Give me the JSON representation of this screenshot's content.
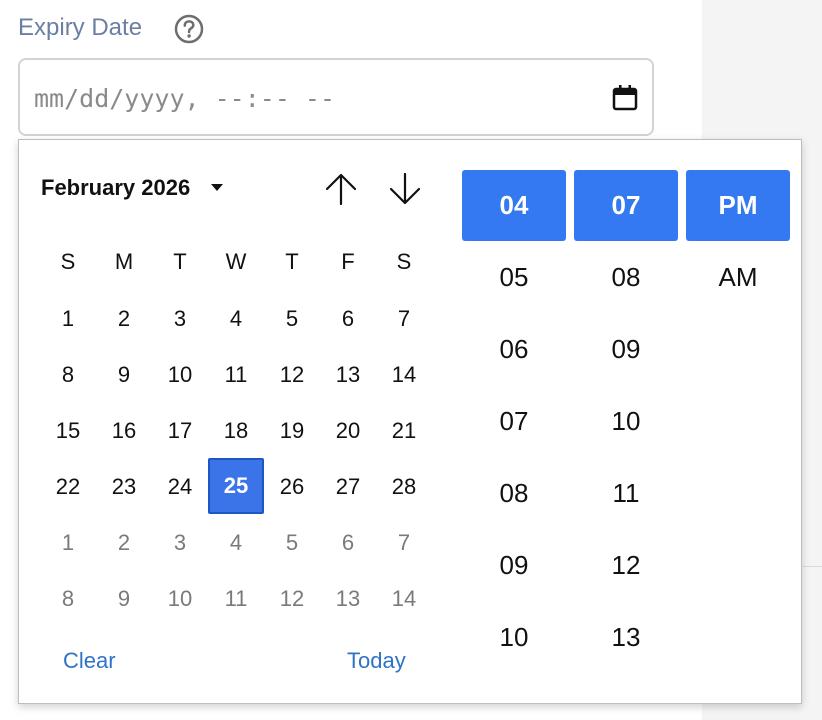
{
  "field": {
    "label": "Expiry Date",
    "placeholder": "mm/dd/yyyy, --:-- --"
  },
  "picker": {
    "month_year": "February 2026",
    "weekdays": [
      "S",
      "M",
      "T",
      "W",
      "T",
      "F",
      "S"
    ],
    "weeks": [
      [
        {
          "d": "1",
          "o": false
        },
        {
          "d": "2",
          "o": false
        },
        {
          "d": "3",
          "o": false
        },
        {
          "d": "4",
          "o": false
        },
        {
          "d": "5",
          "o": false
        },
        {
          "d": "6",
          "o": false
        },
        {
          "d": "7",
          "o": false
        }
      ],
      [
        {
          "d": "8",
          "o": false
        },
        {
          "d": "9",
          "o": false
        },
        {
          "d": "10",
          "o": false
        },
        {
          "d": "11",
          "o": false
        },
        {
          "d": "12",
          "o": false
        },
        {
          "d": "13",
          "o": false
        },
        {
          "d": "14",
          "o": false
        }
      ],
      [
        {
          "d": "15",
          "o": false
        },
        {
          "d": "16",
          "o": false
        },
        {
          "d": "17",
          "o": false
        },
        {
          "d": "18",
          "o": false
        },
        {
          "d": "19",
          "o": false
        },
        {
          "d": "20",
          "o": false
        },
        {
          "d": "21",
          "o": false
        }
      ],
      [
        {
          "d": "22",
          "o": false
        },
        {
          "d": "23",
          "o": false
        },
        {
          "d": "24",
          "o": false
        },
        {
          "d": "25",
          "o": false,
          "selected": true
        },
        {
          "d": "26",
          "o": false
        },
        {
          "d": "27",
          "o": false
        },
        {
          "d": "28",
          "o": false
        }
      ],
      [
        {
          "d": "1",
          "o": true
        },
        {
          "d": "2",
          "o": true
        },
        {
          "d": "3",
          "o": true
        },
        {
          "d": "4",
          "o": true
        },
        {
          "d": "5",
          "o": true
        },
        {
          "d": "6",
          "o": true
        },
        {
          "d": "7",
          "o": true
        }
      ],
      [
        {
          "d": "8",
          "o": true
        },
        {
          "d": "9",
          "o": true
        },
        {
          "d": "10",
          "o": true
        },
        {
          "d": "11",
          "o": true
        },
        {
          "d": "12",
          "o": true
        },
        {
          "d": "13",
          "o": true
        },
        {
          "d": "14",
          "o": true
        }
      ]
    ],
    "clear_label": "Clear",
    "today_label": "Today",
    "hours": [
      "04",
      "05",
      "06",
      "07",
      "08",
      "09",
      "10"
    ],
    "minutes": [
      "07",
      "08",
      "09",
      "10",
      "11",
      "12",
      "13"
    ],
    "meridiem": [
      "PM",
      "AM"
    ],
    "selected_hour": "04",
    "selected_minute": "07",
    "selected_meridiem": "PM",
    "accent_color": "#3479f2",
    "link_color": "#2f73c7"
  }
}
